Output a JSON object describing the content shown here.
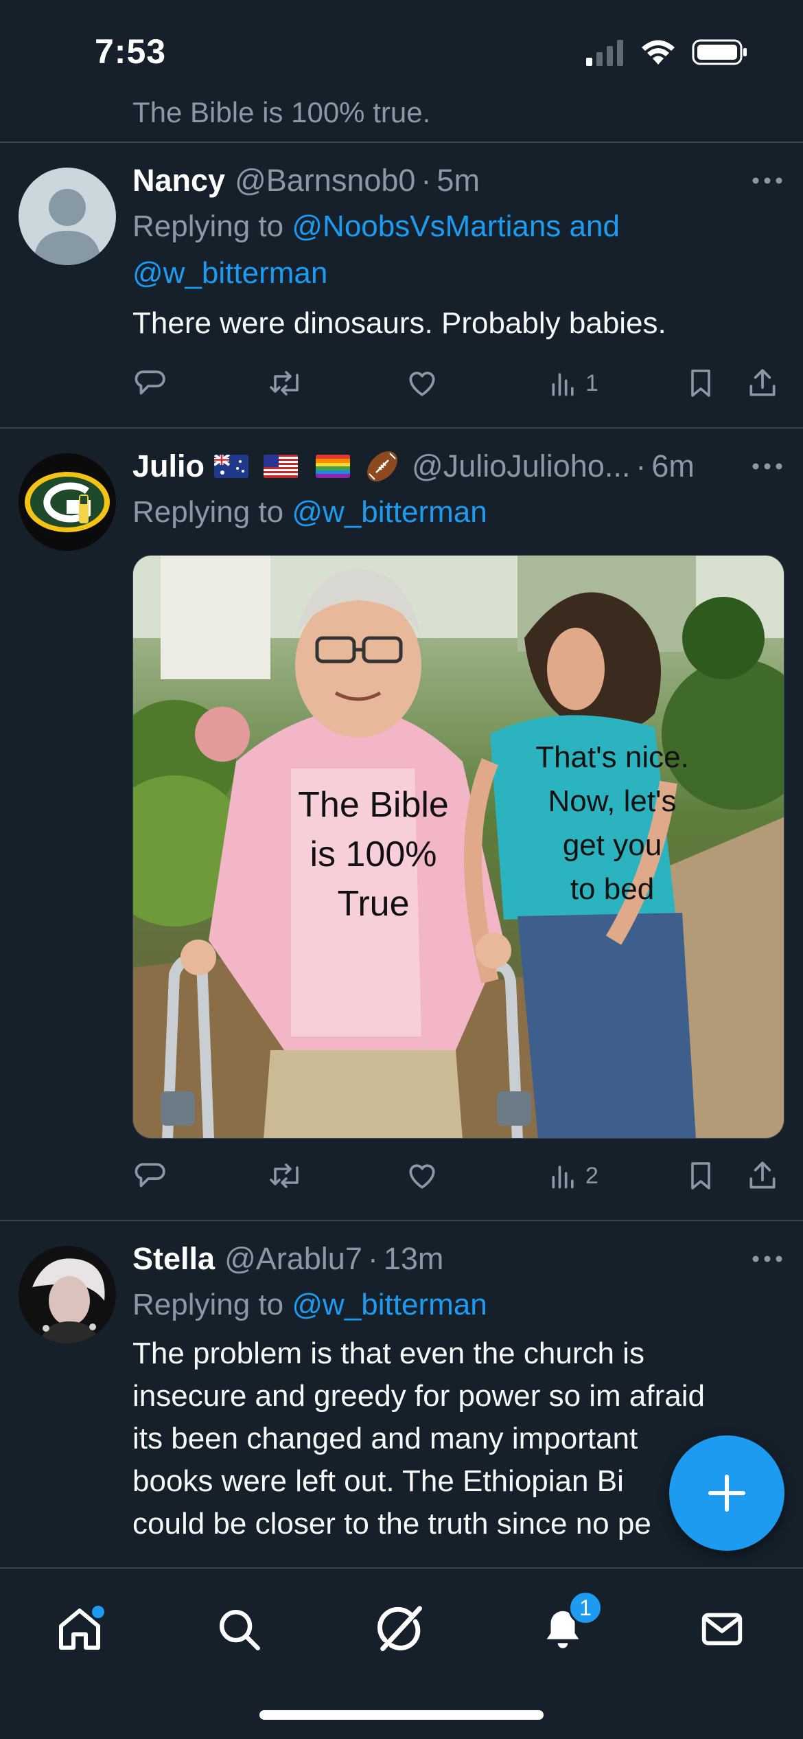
{
  "status_bar": {
    "time": "7:53"
  },
  "previous_tweet": {
    "text": "The Bible is 100% true."
  },
  "tweets": [
    {
      "name": "Nancy",
      "handle": "@Barnsnob0",
      "separator": "·",
      "time": "5m",
      "replying_prefix": "Replying to",
      "replying_to_line1": "@NoobsVsMartians and",
      "replying_to_line2": "@w_bitterman",
      "text": "There were dinosaurs. Probably babies.",
      "views": "1"
    },
    {
      "name": "Julio",
      "handle": "@JulioJulioho...",
      "separator": "·",
      "time": "6m",
      "replying_prefix": "Replying to",
      "replying_to": "@w_bitterman",
      "meme_left_text": [
        "The Bible",
        "is 100%",
        "True"
      ],
      "meme_right_text": [
        "That's nice.",
        "Now, let's",
        "get you",
        "to bed"
      ],
      "views": "2"
    },
    {
      "name": "Stella",
      "handle": "@Arablu7",
      "separator": "·",
      "time": "13m",
      "replying_prefix": "Replying to",
      "replying_to": "@w_bitterman",
      "text_lines": [
        "The problem is that even the church is",
        "insecure and greedy for power so im afraid",
        "its been changed and many important",
        "books were left out. The Ethiopian Bi",
        "could be closer to the truth since no pe       s"
      ]
    }
  ],
  "tab_bar": {
    "items": [
      "home-icon",
      "search-icon",
      "grok-icon",
      "notifications-icon",
      "messages-icon"
    ],
    "notifications_badge": "1"
  },
  "colors": {
    "background": "#15202b",
    "accent": "#1d9bf0",
    "secondary_text": "#8b98a5",
    "divider": "#38444d"
  }
}
